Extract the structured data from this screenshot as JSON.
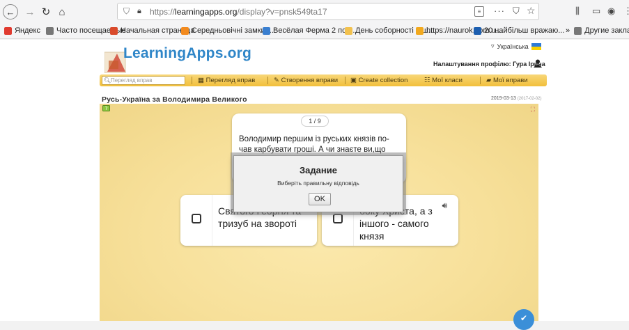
{
  "browser": {
    "url_prefix": "https://",
    "url_host": "learningapps.org",
    "url_path": "/display?v=pnsk549ta17",
    "more_label": "···"
  },
  "bookmarks": [
    {
      "label": "Яндекс",
      "color": "#e03a2f"
    },
    {
      "label": "Часто посещаемые",
      "color": "#777777"
    },
    {
      "label": "Начальная страница",
      "color": "#d94a2b"
    },
    {
      "label": "Середньовічні замки ...",
      "color": "#f28a1e"
    },
    {
      "label": "Весёлая Ферма 2 пол...",
      "color": "#3a7fd0"
    },
    {
      "label": "День соборності в ш...",
      "color": "#f2c14e"
    },
    {
      "label": "https://naurok.com.u...",
      "color": "#f2a91e"
    },
    {
      "label": "20 найбільш вражаю...",
      "color": "#1d5fb0"
    },
    {
      "label": "Другие заклад",
      "color": "#777777"
    }
  ],
  "site": {
    "logo": "LearningApps.org",
    "language": "Українська",
    "profile": "Налаштування профілю: Гура Ірина",
    "search_placeholder": "Перегляд вправ",
    "menu": [
      "Перегляд вправ",
      "Створення вправи",
      "Create collection",
      "Мої класи",
      "Мої вправи"
    ]
  },
  "exercise": {
    "title": "Русь-Україна за Володимира Великого",
    "date": "2019-03-13",
    "date_extra": "(2017-02-02)",
    "counter": "1 / 9",
    "question": "Володимир першим із руських князів по-чав карбувати гроші. А чи знаєте ви,що",
    "answers": [
      {
        "text": "Святого Георгія та тризуб на звороті"
      },
      {
        "text": "боку Христа, а з іншого - самого князя"
      }
    ]
  },
  "dialog": {
    "title": "Задание",
    "message": "Виберіть правильну відповідь",
    "ok_label": "OK"
  },
  "colors": {
    "accent": "#2f86c8",
    "menubar": "#f1bf3b",
    "app_bg": "#f7e09a",
    "fab": "#3b8fd8"
  }
}
